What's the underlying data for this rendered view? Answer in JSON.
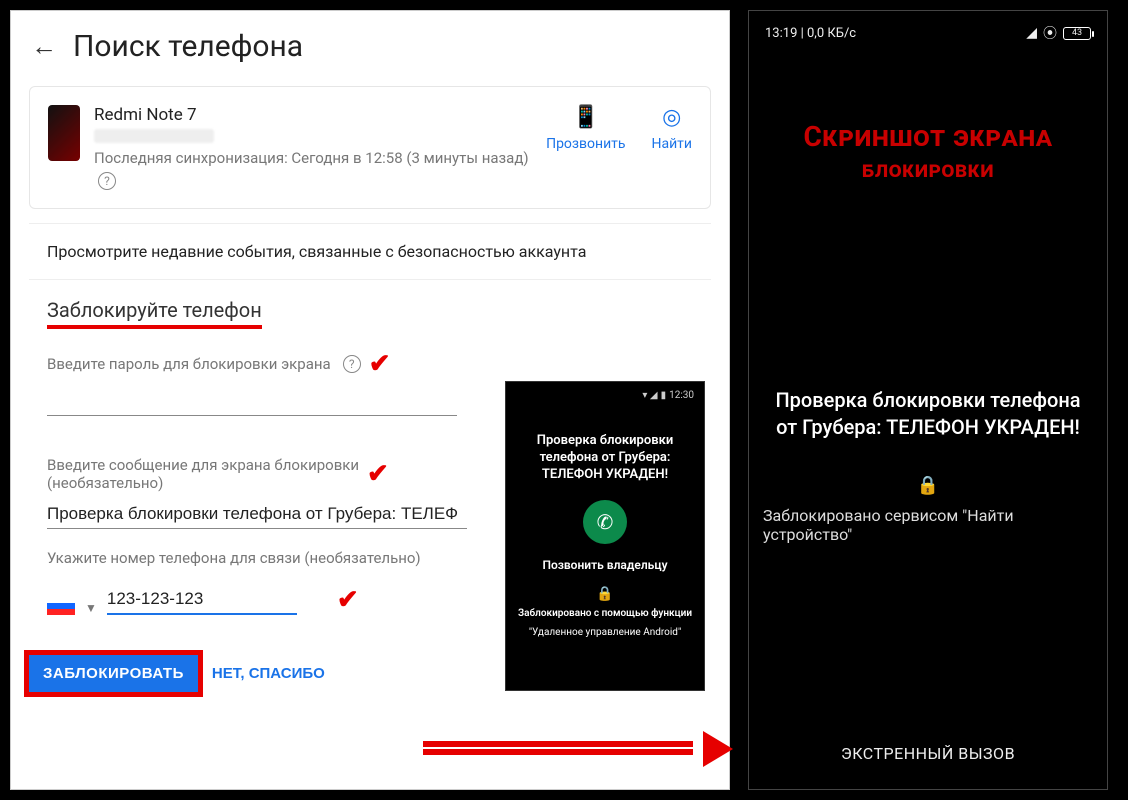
{
  "app": {
    "title": "Поиск телефона"
  },
  "device": {
    "name": "Redmi Note 7",
    "sync": "Последняя синхронизация: Сегодня в 12:58 (3 минуты назад)"
  },
  "actions": {
    "ring": "Прозвонить",
    "find": "Найти"
  },
  "events": {
    "text": "Просмотрите недавние события, связанные с безопасностью аккаунта"
  },
  "lock": {
    "title": "Заблокируйте телефон",
    "pw_label": "Введите пароль для блокировки экрана",
    "msg_label1": "Введите сообщение для экрана блокировки",
    "msg_label2": "(необязательно)",
    "msg_value": "Проверка блокировки телефона от Грубера: ТЕЛЕФ",
    "phone_label": "Укажите номер телефона для связи (необязательно)",
    "phone_value": "123-123-123",
    "primary": "ЗАБЛОКИРОВАТЬ",
    "cancel": "НЕТ, СПАСИБО"
  },
  "mini": {
    "status_time": "12:30",
    "msg": "Проверка блокировки телефона от Грубера: ТЕЛЕФОН УКРАДЕН!",
    "call": "Позвонить владельцу",
    "foot1": "Заблокировано с помощью функции",
    "foot2": "\"Удаленное управление Android\""
  },
  "right": {
    "status_left": "13:19 | 0,0 КБ/с",
    "batt": "43",
    "heading_line1": "Скриншот экрана",
    "heading_line2": "блокировки",
    "msg": "Проверка блокировки телефона от Грубера: ТЕЛЕФОН УКРАДЕН!",
    "sub": "Заблокировано сервисом \"Найти устройство\"",
    "emergency": "ЭКСТРЕННЫЙ ВЫЗОВ"
  }
}
